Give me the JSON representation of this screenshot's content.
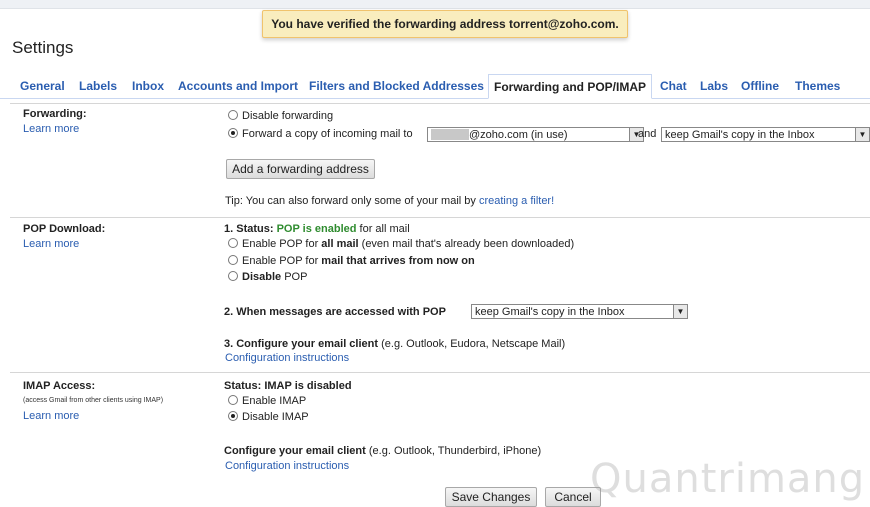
{
  "notification": "You have verified the forwarding address torrent@zoho.com.",
  "page_title": "Settings",
  "tabs": [
    {
      "label": "General"
    },
    {
      "label": "Labels"
    },
    {
      "label": "Inbox"
    },
    {
      "label": "Accounts and Import"
    },
    {
      "label": "Filters and Blocked Addresses"
    },
    {
      "label": "Forwarding and POP/IMAP"
    },
    {
      "label": "Chat"
    },
    {
      "label": "Labs"
    },
    {
      "label": "Offline"
    },
    {
      "label": "Themes"
    }
  ],
  "forwarding": {
    "title": "Forwarding:",
    "learn_more": "Learn more",
    "disable_label": "Disable forwarding",
    "forward_label": "Forward a copy of incoming mail to",
    "address_value": "@zoho.com (in use)",
    "and": "and",
    "action_value": "keep Gmail's copy in the Inbox",
    "add_button": "Add a forwarding address",
    "tip": "Tip: You can also forward only some of your mail by",
    "tip_link": "creating a filter!"
  },
  "pop": {
    "title": "POP Download:",
    "learn_more": "Learn more",
    "status_prefix": "1. Status:",
    "status_value": "POP is enabled",
    "status_suffix": "for all mail",
    "opt1_a": "Enable POP for",
    "opt1_b": "all mail",
    "opt1_c": "(even mail that's already been downloaded)",
    "opt2_a": "Enable POP for",
    "opt2_b": "mail that arrives from now on",
    "opt3": "Disable",
    "opt3_b": "POP",
    "access_label": "2. When messages are accessed with POP",
    "access_value": "keep Gmail's copy in the Inbox",
    "configure_label": "3. Configure your email client",
    "configure_eg": "(e.g. Outlook, Eudora, Netscape Mail)",
    "config_link": "Configuration instructions"
  },
  "imap": {
    "title": "IMAP Access:",
    "subtitle": "(access Gmail from other clients using IMAP)",
    "learn_more": "Learn more",
    "status": "Status: IMAP is disabled",
    "enable": "Enable IMAP",
    "disable": "Disable IMAP",
    "configure_label": "Configure your email client",
    "configure_eg": "(e.g. Outlook, Thunderbird, iPhone)",
    "config_link": "Configuration instructions"
  },
  "buttons": {
    "save": "Save Changes",
    "cancel": "Cancel"
  },
  "watermark": "Quantrimang"
}
